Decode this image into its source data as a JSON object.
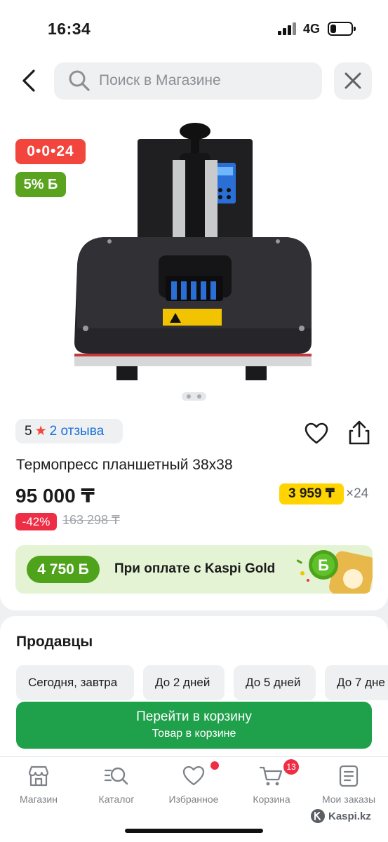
{
  "status_bar": {
    "time": "16:34",
    "network": "4G"
  },
  "search": {
    "placeholder": "Поиск в Магазине"
  },
  "icons": {
    "back": "chevron-left-icon",
    "search": "search-icon",
    "close": "close-icon",
    "favorite": "heart-icon",
    "share": "share-icon"
  },
  "badges": {
    "timer": "0•0•24",
    "bonus": "5% Б"
  },
  "rating": {
    "score": "5",
    "reviews": "2 отзыва"
  },
  "product": {
    "title": "Термопресс планшетный 38x38",
    "price": "95 000 ₸",
    "discount": "-42%",
    "old_price": "163 298 ₸",
    "installment_price": "3 959 ₸",
    "installment_count": "×24",
    "gallery_count": 2
  },
  "kaspi_gold": {
    "amount": "4 750 Б",
    "text": "При оплате с Kaspi Gold"
  },
  "sellers": {
    "title": "Продавцы",
    "chips": [
      "Сегодня, завтра",
      "До 2 дней",
      "До 5 дней",
      "До 7 дне"
    ]
  },
  "cart_button": {
    "title": "Перейти в корзину",
    "subtitle": "Товар в корзине"
  },
  "tabs": [
    {
      "label": "Магазин",
      "icon": "store-icon"
    },
    {
      "label": "Каталог",
      "icon": "catalog-search-icon"
    },
    {
      "label": "Избранное",
      "icon": "heart-icon"
    },
    {
      "label": "Корзина",
      "icon": "cart-icon"
    },
    {
      "label": "Мои заказы",
      "icon": "orders-icon"
    }
  ],
  "cart_badge": "13",
  "watermark": "Kaspi.kz",
  "colors": {
    "accent_green": "#1fa04a",
    "red": "#f2453d",
    "bonus_green": "#5aa31e",
    "installment_yellow": "#ffd400",
    "link_blue": "#1a6fd8"
  }
}
